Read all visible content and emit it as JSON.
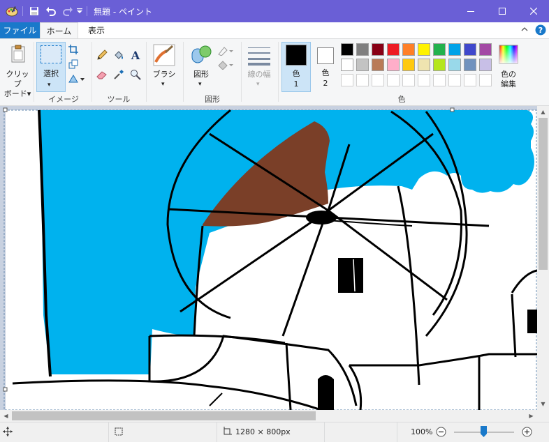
{
  "window": {
    "title": "無題 - ペイント"
  },
  "tabs": {
    "file": "ファイル",
    "home": "ホーム",
    "view": "表示"
  },
  "ribbon": {
    "clipboard_label": "クリップ\nボード",
    "clipboard_line1": "クリップ",
    "clipboard_line2": "ボード",
    "select_label": "選択",
    "image_group": "イメージ",
    "tools_group": "ツール",
    "brush_label": "ブラシ",
    "shapes_label": "図形",
    "shapes_group": "図形",
    "line_width_label": "線の幅",
    "color1_label": "色",
    "color1_num": "1",
    "color2_label": "色",
    "color2_num": "2",
    "edit_colors_line1": "色の",
    "edit_colors_line2": "編集",
    "colors_group": "色"
  },
  "palette": {
    "row1": [
      "#000000",
      "#7f7f7f",
      "#880015",
      "#ed1c24",
      "#ff7f27",
      "#fff200",
      "#22b14c",
      "#00a2e8",
      "#3f48cc",
      "#a349a4"
    ],
    "row2": [
      "#ffffff",
      "#c3c3c3",
      "#b97a57",
      "#ffaec9",
      "#ffc90e",
      "#efe4b0",
      "#b5e61d",
      "#99d9ea",
      "#7092be",
      "#c8bfe7"
    ],
    "row3": [
      "#ffffff",
      "#ffffff",
      "#ffffff",
      "#ffffff",
      "#ffffff",
      "#ffffff",
      "#ffffff",
      "#ffffff",
      "#ffffff",
      "#ffffff"
    ],
    "color1": "#000000",
    "color2": "#ffffff",
    "accent": "#1979ca",
    "title_bg": "#6a5fd6"
  },
  "status": {
    "dimensions": "1280 × 800px",
    "zoom": "100%",
    "zoom_level": 1.0
  }
}
